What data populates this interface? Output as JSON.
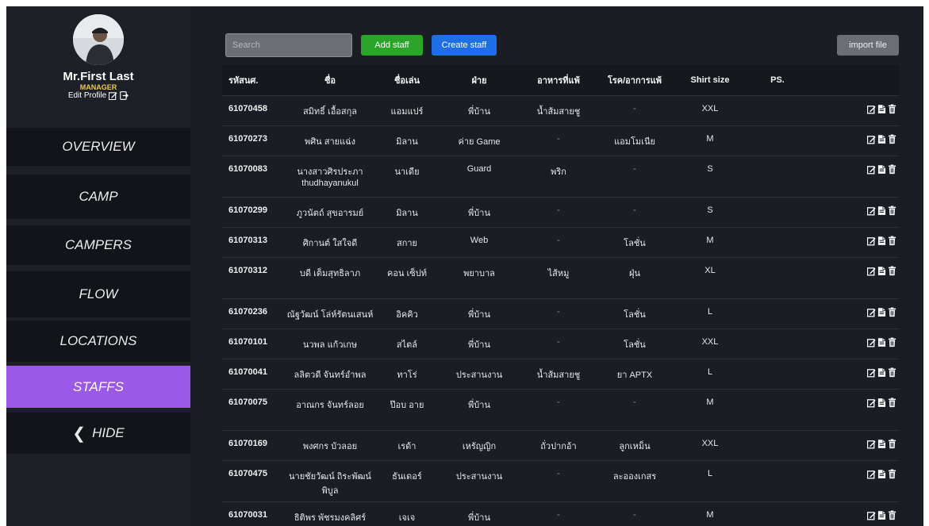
{
  "profile": {
    "name": "Mr.First Last",
    "role": "MANAGER",
    "edit_label": "Edit Profile"
  },
  "nav": {
    "overview": "OVERVIEW",
    "camp": "CAMP",
    "campers": "CAMPERS",
    "flow": "FLOW",
    "locations": "LOCATIONS",
    "staffs": "STAFFS",
    "hide": "HIDE"
  },
  "toolbar": {
    "search_placeholder": "Search",
    "add_staff": "Add staff",
    "create_staff": "Create staff",
    "import_file": "import file"
  },
  "table": {
    "headers": [
      "รหัสนศ.",
      "ชื่อ",
      "ชื่อเล่น",
      "ฝ่าย",
      "อาหารที่แพ้",
      "โรค/อาการแพ้",
      "Shirt size",
      "PS."
    ],
    "rows": [
      [
        "61070458",
        "สมิทธิ์ เอื้อสกุล",
        "แอมแปร์",
        "พี่บ้าน",
        "น้ำส้มสายชู",
        "-",
        "XXL",
        ""
      ],
      [
        "61070273",
        "พศิน สายแฉ่ง",
        "มิลาน",
        "ค่าย Game",
        "-",
        "แอมโมเนีย",
        "M",
        ""
      ],
      [
        "61070083",
        "นางสาวศิรประภา thudhayanukul",
        "นาเดีย",
        "Guard",
        "พริก",
        "-",
        "S",
        ""
      ],
      [
        "61070299",
        "ภูวนัตถ์ สุขอารมย์",
        "มิลาน",
        "พี่บ้าน",
        "-",
        "-",
        "S",
        ""
      ],
      [
        "61070313",
        "ศิกานต์ ใสใจดี",
        "สกาย",
        "Web",
        "-",
        "โลชั่น",
        "M",
        ""
      ],
      [
        "61070312",
        "บดี เต็มสุทธิลาภ",
        "คอน เซ็ปท์",
        "พยาบาล",
        "ไส้หมู",
        "ฝุ่น",
        "XL",
        ""
      ],
      [
        "61070236",
        "ณัฐวัฒน์ โล่ห์รัตนเสนห์",
        "อิคคิว",
        "พี่บ้าน",
        "-",
        "โลชั่น",
        "L",
        ""
      ],
      [
        "61070101",
        "นวพล แก้วเกษ",
        "สไตล์",
        "พี่บ้าน",
        "-",
        "โลชั่น",
        "XXL",
        ""
      ],
      [
        "61070041",
        "ลลิตวดี จันทร์อำพล",
        "ทาโร่",
        "ประสานงาน",
        "น้ำส้มสายชู",
        "ยา APTX",
        "L",
        ""
      ],
      [
        "61070075",
        "อาณกร จันทร์ลอย",
        "ป๊อบ อาย",
        "พี่บ้าน",
        "-",
        "-",
        "M",
        ""
      ],
      [
        "61070169",
        "พงศกร บัวลอย",
        "เรด้า",
        "เหรัญญิก",
        "ถั่วปากอ้า",
        "ลูกเหม็น",
        "XXL",
        ""
      ],
      [
        "61070475",
        "นายชัยวัฒน์ ถิระพัฒน์ พิบูล",
        "ธันเดอร์",
        "ประสานงาน",
        "-",
        "ละอองเกสร",
        "L",
        ""
      ],
      [
        "61070031",
        "ธิติพร พัชรมงคลิศร์",
        "เจเจ",
        "พี่บ้าน",
        "-",
        "-",
        "M",
        ""
      ]
    ]
  },
  "colors": {
    "accent": "#9b59e8",
    "role": "#f0c94a",
    "add": "#2aa52a",
    "create": "#1e6fe6"
  }
}
